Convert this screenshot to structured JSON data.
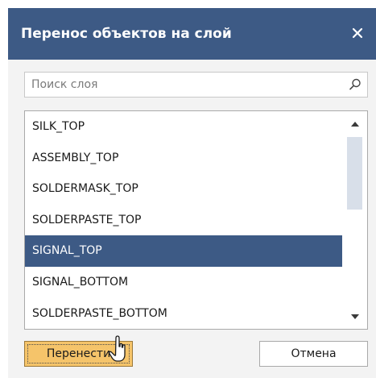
{
  "dialog": {
    "title": "Перенос объектов на слой",
    "close_glyph": "✕"
  },
  "search": {
    "placeholder": "Поиск слоя",
    "value": ""
  },
  "layers": {
    "items": [
      {
        "label": "SILK_TOP",
        "selected": false
      },
      {
        "label": "ASSEMBLY_TOP",
        "selected": false
      },
      {
        "label": "SOLDERMASK_TOP",
        "selected": false
      },
      {
        "label": "SOLDERPASTE_TOP",
        "selected": false
      },
      {
        "label": "SIGNAL_TOP",
        "selected": true
      },
      {
        "label": "SIGNAL_BOTTOM",
        "selected": false
      },
      {
        "label": "SOLDERPASTE_BOTTOM",
        "selected": false
      }
    ]
  },
  "buttons": {
    "move_label": "Перенести",
    "cancel_label": "Отмена"
  },
  "colors": {
    "titlebar": "#3d5a85",
    "selection": "#3d5a85",
    "primary_button": "#f5c46a"
  },
  "icons": {
    "close": "close-icon",
    "search": "search-icon",
    "scroll_up": "chevron-up-icon",
    "scroll_down": "chevron-down-icon",
    "cursor": "mouse-pointer-icon"
  }
}
